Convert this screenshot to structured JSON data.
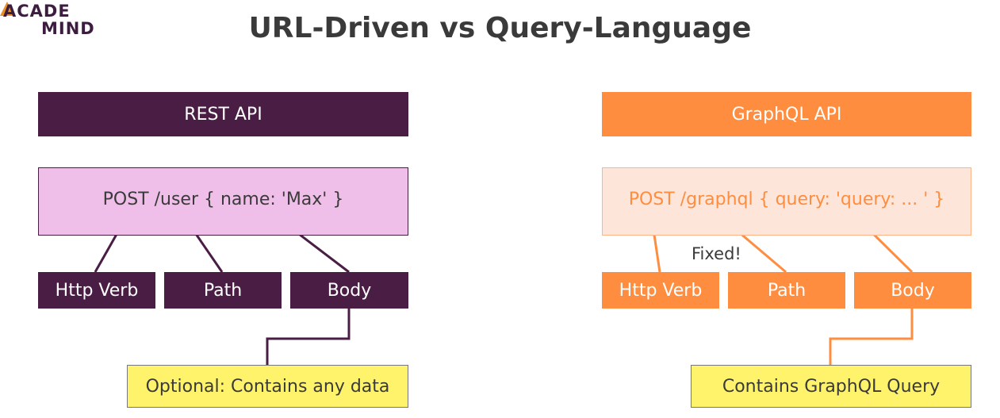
{
  "logo": {
    "line1": "ACADE",
    "line2": "MIND"
  },
  "title": "URL-Driven vs Query-Language",
  "rest": {
    "header": "REST API",
    "request": "POST /user { name: 'Max' }",
    "parts": [
      "Http Verb",
      "Path",
      "Body"
    ],
    "note": "Optional: Contains any data"
  },
  "graphql": {
    "header": "GraphQL API",
    "request": "POST /graphql { query: 'query: ... ' }",
    "parts": [
      "Http Verb",
      "Path",
      "Body"
    ],
    "fixed_label": "Fixed!",
    "note": "Contains GraphQL Query"
  },
  "colors": {
    "rest_dark": "#4a1d45",
    "rest_light": "#efbfe9",
    "graphql_orange": "#ff8d40",
    "graphql_light": "#fde6d9",
    "rest_underline": "#fff36b",
    "graphql_underline": "#b03a2e",
    "note_yellow": "#fff36b"
  }
}
